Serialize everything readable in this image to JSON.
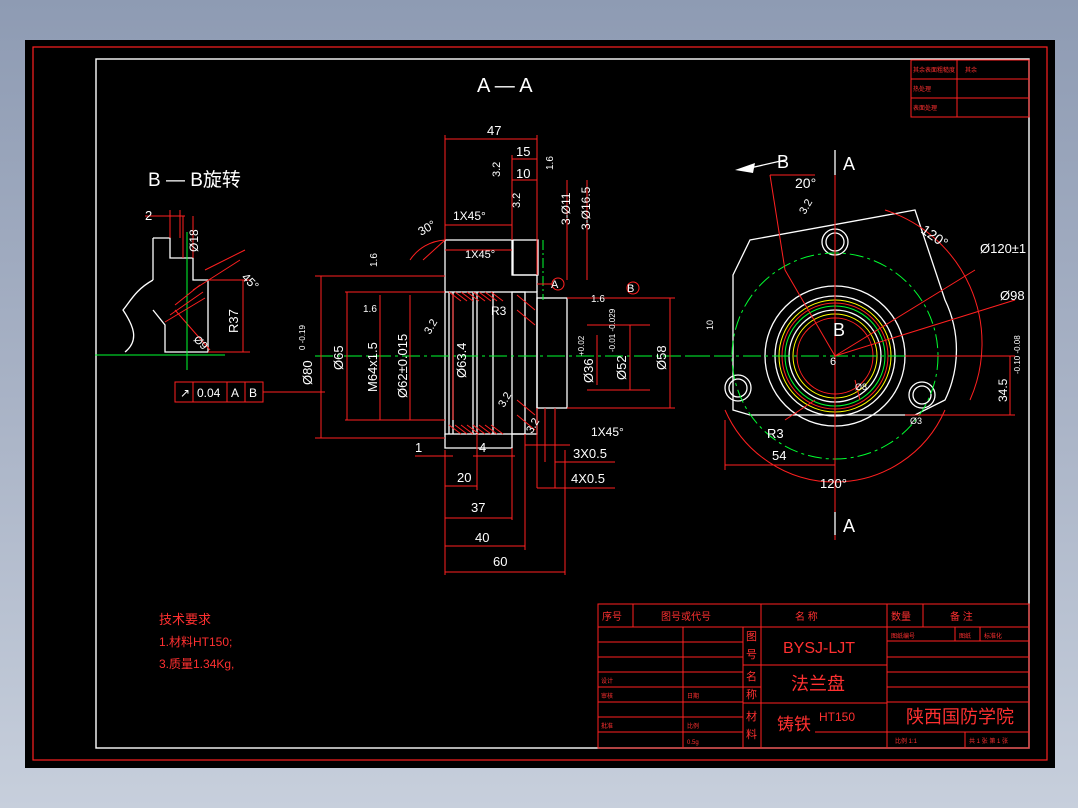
{
  "section_labels": {
    "aa": "A — A",
    "bb": "B — B旋转",
    "a_top": "A",
    "a_bottom": "A",
    "b_arrow": "B",
    "b_center": "B"
  },
  "dims_left": {
    "d47": "47",
    "d15": "15",
    "d10": "10",
    "d32a": "3.2",
    "d32b": "3.2",
    "d32c": "3.2",
    "d32d": "3.2",
    "d32e": "3.2",
    "d16a": "1.6",
    "d16b": "1.6",
    "d16c": "1.6",
    "d16d": "1.6",
    "d3_11": "3-Ø11",
    "d3_165": "3-Ø16.5",
    "chamfer1": "1X45°",
    "chamfer2": "1X45°",
    "chamfer3": "1X45°",
    "ang30": "30°",
    "ang45": "45°",
    "r3": "R3",
    "d2": "2",
    "d18": "Ø18",
    "r37": "R37",
    "d9": "Ø9",
    "d80": "Ø80",
    "d80tol": "0 -0.19",
    "d65": "Ø65",
    "m64": "M64x1.5",
    "d62": "Ø62±0.015",
    "d634": "Ø63.4",
    "d36": "Ø36",
    "d36tol": "+0.02",
    "d52": "Ø52",
    "d52tol": "-0.01 -0.029",
    "d58": "Ø58",
    "d1": "1",
    "d4": "4",
    "d20": "20",
    "d37": "37",
    "d40": "40",
    "d60": "60",
    "g3x05": "3X0.5",
    "g4x05": "4X0.5",
    "datum_a": "A",
    "datum_b": "B"
  },
  "tolerance_frame": {
    "symbol": "↗",
    "value": "0.04",
    "datum1": "A",
    "datum2": "B"
  },
  "dims_right": {
    "ang20": "20°",
    "ang120a": "120°",
    "ang120b": "120°",
    "d120": "Ø120±1",
    "d98": "Ø98",
    "d345": "34.5",
    "d345tol": "-0.10 -0.08",
    "r3": "R3",
    "d54": "54",
    "d6": "6",
    "d32": "3.2",
    "d10": "10",
    "d8": "Ø8",
    "d3": "Ø3"
  },
  "tech_req": {
    "title": "技术要求",
    "line1": "1.材料HT150;",
    "line2": "3.质量1.34Kg,"
  },
  "top_table": {
    "r1c1": "其余表面粗糙度",
    "r1c2": "其余",
    "r2c1": "热处理",
    "r3c1": "表面处理"
  },
  "title_block": {
    "h_seq": "序号",
    "h_code": "图号或代号",
    "h_name": "名    称",
    "h_qty": "数量",
    "h_remark": "备    注",
    "label_tu": "图",
    "label_hao": "号",
    "label_ming": "名",
    "label_cheng": "称",
    "label_cai": "材",
    "label_liao": "料",
    "drawing_no": "BYSJ-LJT",
    "part_name": "法兰盘",
    "material": "铸铁",
    "material_code": "HT150",
    "school": "陕西国防学院",
    "small1": "比例  1:1",
    "small2": "共 1 张  第 1 张",
    "row_a1": "设计",
    "row_a2": "审核",
    "row_a3": "批准",
    "row_b1": "日期",
    "row_b2": "比例",
    "row_b3": "0.5g",
    "upper_right1": "图纸编号",
    "upper_right2": "图纸",
    "upper_right3": "标准化"
  }
}
